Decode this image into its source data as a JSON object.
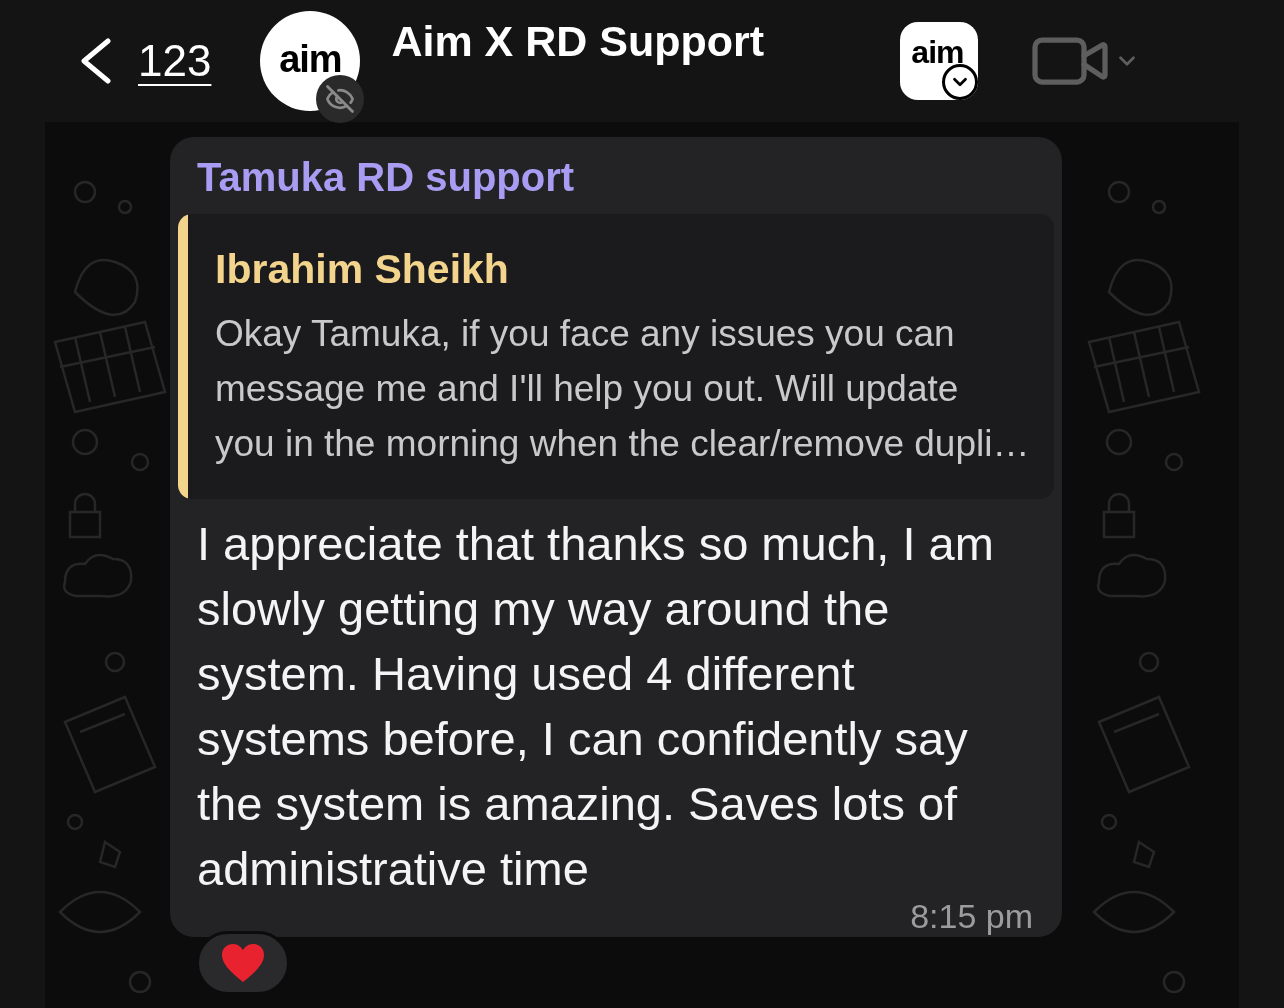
{
  "header": {
    "back_count": "123",
    "avatar_logo": "aim",
    "title": "Aim X RD Support",
    "app_icon_logo": "aim"
  },
  "message": {
    "sender": "Tamuka RD support",
    "quote": {
      "author": "Ibrahim Sheikh",
      "text": "Okay Tamuka, if you face any issues you can\nmessage me and I'll help you out. Will update\nyou in the morning when the clear/remove dupli…"
    },
    "text": "I appreciate that thanks so much, I am slowly getting my way around the system. Having used 4 different systems before, I can confidently say the system is amazing. Saves lots of administrative time",
    "time": "8:15 pm",
    "reactions": [
      {
        "kind": "heart"
      }
    ]
  }
}
